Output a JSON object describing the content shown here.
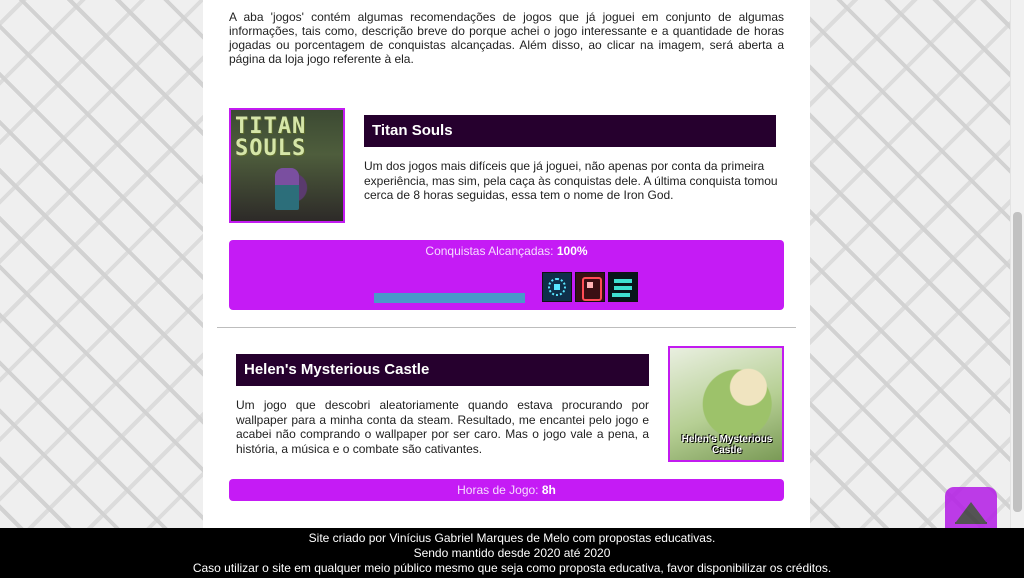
{
  "intro": "A aba 'jogos' contém algumas recomendações de jogos que já joguei em conjunto de algumas informações, tais como, descrição breve do porque achei o jogo interessante e a quantidade de horas jogadas ou porcentagem de conquistas alcançadas. Além disso, ao clicar na imagem, será aberta a página da loja jogo referente à ela.",
  "games": [
    {
      "title": "Titan Souls",
      "thumb_text": "TITAN SOULS",
      "description": "Um dos jogos mais difíceis que já joguei, não apenas por conta da primeira experiência, mas sim, pela caça às conquistas dele. A última conquista tomou cerca de 8 horas seguidas, essa tem o nome de Iron God.",
      "stat_label": "Conquistas Alcançadas:",
      "stat_value": "100%",
      "progress": 1.0,
      "achievement_icons": [
        "achievement-icon-1",
        "achievement-icon-2",
        "achievement-icon-3"
      ]
    },
    {
      "title": "Helen's Mysterious Castle",
      "thumb_text": "Helen's Mysterious Castle",
      "description": "Um jogo que descobri aleatoriamente quando estava procurando por wallpaper para a minha conta da steam. Resultado, me encantei pelo jogo e acabei não comprando o wallpaper por ser caro. Mas o jogo vale a pena, a história, a música e o combate são cativantes.",
      "stat_label": "Horas de Jogo:",
      "stat_value": "8h"
    }
  ],
  "back_to_top_icon": "arrow-up-icon",
  "footer": {
    "line1": "Site criado por Vinícius Gabriel Marques de Melo com propostas educativas.",
    "line2": "Sendo mantido desde 2020 até 2020",
    "line3": "Caso utilizar o site em qualquer meio público mesmo que seja como proposta educativa, favor disponibilizar os créditos."
  },
  "colors": {
    "accent": "#c51bf5",
    "title_bar": "#26002e",
    "progress": "#4a98c9"
  }
}
